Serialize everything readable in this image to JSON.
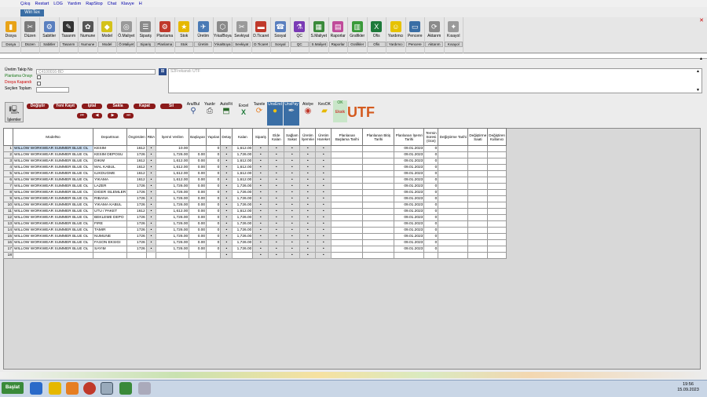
{
  "menu": [
    "Çıkış",
    "Restart",
    "LOG",
    "Yardım",
    "RapStop",
    "Chat",
    "Klavye",
    "H"
  ],
  "window_title": "WinTex",
  "toolbar": [
    {
      "label": "Dosya",
      "sub": "Dosya",
      "color": "#e8a317",
      "glyph": "▮"
    },
    {
      "label": "Düzen",
      "sub": "Düzen",
      "color": "#7a7a7a",
      "glyph": "✂"
    },
    {
      "label": "Sabitler",
      "sub": "Sabitler",
      "color": "#5a7fbf",
      "glyph": "⚙"
    },
    {
      "label": "Tasarım",
      "sub": "Tasarım",
      "color": "#333",
      "glyph": "✎"
    },
    {
      "label": "Numune",
      "sub": "Numune",
      "color": "#555",
      "glyph": "✿"
    },
    {
      "label": "Model",
      "sub": "Model",
      "color": "#d4c21a",
      "glyph": "◆"
    },
    {
      "label": "Ö.Maliyet",
      "sub": "Ö.Maliyet",
      "color": "#9a9a9a",
      "glyph": "◎"
    },
    {
      "label": "Sipariş",
      "sub": "Sipariş",
      "color": "#8a8a8a",
      "glyph": "☰"
    },
    {
      "label": "Planlama",
      "sub": "Planlama",
      "color": "#c0392b",
      "glyph": "⚙"
    },
    {
      "label": "Stok",
      "sub": "Stok",
      "color": "#e6b800",
      "glyph": "★"
    },
    {
      "label": "Üretim",
      "sub": "Üretim",
      "color": "#4a7ab5",
      "glyph": "✈"
    },
    {
      "label": "Yıka/Boya",
      "sub": "Yıka/Boya",
      "color": "#8a8a8a",
      "glyph": "⬡"
    },
    {
      "label": "Sevkiyat",
      "sub": "Sevkiyat",
      "color": "#9a9a9a",
      "glyph": "✂"
    },
    {
      "label": "D.Ticaret",
      "sub": "D.Ticaret",
      "color": "#c0392b",
      "glyph": "▬"
    },
    {
      "label": "Sosyal",
      "sub": "Sosyal",
      "color": "#5a7fbf",
      "glyph": "☎"
    },
    {
      "label": "QC",
      "sub": "QC",
      "color": "#7a3ab5",
      "glyph": "⚗"
    },
    {
      "label": "S.Maliyet",
      "sub": "S.Maliyet",
      "color": "#3a8a3a",
      "glyph": "▦"
    },
    {
      "label": "Raporlar",
      "sub": "Raporlar",
      "color": "#c04a9a",
      "glyph": "▤"
    },
    {
      "label": "Grafikler",
      "sub": "Grafikler",
      "color": "#3a9a3a",
      "glyph": "▥"
    },
    {
      "label": "Ofis",
      "sub": "Ofis",
      "color": "#1e7a3a",
      "glyph": "X"
    },
    {
      "label": "Yardımcı",
      "sub": "Yardımcı",
      "color": "#e6c200",
      "glyph": "☺"
    },
    {
      "label": "Pencere",
      "sub": "Pencere",
      "color": "#3a6ea5",
      "glyph": "▭"
    },
    {
      "label": "Aktarım",
      "sub": "Aktarım",
      "color": "#8a8a8a",
      "glyph": "⟳"
    },
    {
      "label": "Kısayol",
      "sub": "Kısayol",
      "color": "#9a9a9a",
      "glyph": "✦"
    }
  ],
  "form": {
    "uretim_takip_label": "Üretim Takip No",
    "uretim_takip_value": "C4100016-BD",
    "planlama_label": "Planlama Onayı",
    "dosya_label": "Dosya Kapandı",
    "secilen_label": "Seçilen Toplam",
    "model_value": "S2Frekanslı UTF"
  },
  "actions": {
    "degistir": "Değiştir",
    "yeni": "Yeni Kayıt",
    "iptal": "İptal",
    "sakla": "Sakla",
    "kapat": "Kapat",
    "sil": "Sil",
    "islemler": "İşlemler",
    "ara": "Ara/Bul",
    "yazdir": "Yazdır",
    "autofit": "AutoFit",
    "excel": "Excel",
    "tazele": "Tazele",
    "unsel": "UnsEnd",
    "unspay": "UnsPay",
    "atolye": "Atolye",
    "kesok": "KesOK",
    "ok": "OK",
    "eksik": "Eksik"
  },
  "utf_label": "UTF",
  "columns": [
    "ModelNo",
    "Departman",
    "Öngörülen",
    "RBA",
    "İşemri Verilen",
    "Başlayan",
    "Yapılan",
    "Detay",
    "Kalan",
    "Sipariş",
    "Elde Kalan",
    "Sağlam Sakat",
    "Üretim İşemriie",
    "Üretim Hareket",
    "Planlanan Başlama Tarihi",
    "Planlanan Bitiş Tarihi",
    "Planlanan İşemri Tarihi",
    "Termin Süresi (Gün)",
    "Değiştirme Tarihi",
    "Değiştirme Saati",
    "Değiştiren Kullanıcı"
  ],
  "rows": [
    {
      "n": "1",
      "model": "WILLOW WORKWEAR SUMMER BLUE OL",
      "dept": "KESIM",
      "ong": "1612",
      "isemri": "10.00",
      "basl": "",
      "yap": "0",
      "kalan": "1,612.00",
      "tarih": "09.01.2023",
      "termin": "0"
    },
    {
      "n": "2",
      "model": "WILLOW WORKWEAR SUMMER BLUE OL",
      "dept": "KESIM DEPOSU",
      "ong": "1726",
      "isemri": "1,726.00",
      "basl": "0.00",
      "yap": "0",
      "kalan": "1,726.00",
      "tarih": "09.01.2023",
      "termin": "0"
    },
    {
      "n": "3",
      "model": "WILLOW WORKWEAR SUMMER BLUE OL",
      "dept": "DIKIM",
      "ong": "1612",
      "isemri": "1,612.00",
      "basl": "0.00",
      "yap": "0",
      "kalan": "1,612.00",
      "tarih": "09.01.2023",
      "termin": "0"
    },
    {
      "n": "4",
      "model": "WILLOW WORKWEAR SUMMER BLUE OL",
      "dept": "MAL KABUL",
      "ong": "1612",
      "isemri": "1,612.00",
      "basl": "0.00",
      "yap": "0",
      "kalan": "1,612.00",
      "tarih": "09.01.2023",
      "termin": "0"
    },
    {
      "n": "5",
      "model": "WILLOW WORKWEAR SUMMER BLUE OL",
      "dept": "ILIKDUGME",
      "ong": "1612",
      "isemri": "1,612.00",
      "basl": "0.00",
      "yap": "0",
      "kalan": "1,612.00",
      "tarih": "09.01.2023",
      "termin": "0"
    },
    {
      "n": "6",
      "model": "WILLOW WORKWEAR SUMMER BLUE OL",
      "dept": "YIKAMA",
      "ong": "1612",
      "isemri": "1,612.00",
      "basl": "0.00",
      "yap": "0",
      "kalan": "1,612.00",
      "tarih": "09.01.2023",
      "termin": "0"
    },
    {
      "n": "7",
      "model": "WILLOW WORKWEAR SUMMER BLUE OL",
      "dept": "LAZER",
      "ong": "1726",
      "isemri": "1,726.00",
      "basl": "0.00",
      "yap": "0",
      "kalan": "1,726.00",
      "tarih": "09.01.2023",
      "termin": "0"
    },
    {
      "n": "8",
      "model": "WILLOW WORKWEAR SUMMER BLUE OL",
      "dept": "DIGER ISLEMLER",
      "ong": "1726",
      "isemri": "1,726.00",
      "basl": "0.00",
      "yap": "0",
      "kalan": "1,726.00",
      "tarih": "09.01.2023",
      "termin": "0"
    },
    {
      "n": "9",
      "model": "WILLOW WORKWEAR SUMMER BLUE OL",
      "dept": "RIBANA",
      "ong": "1726",
      "isemri": "1,726.00",
      "basl": "0.00",
      "yap": "0",
      "kalan": "1,726.00",
      "tarih": "09.01.2023",
      "termin": "0"
    },
    {
      "n": "10",
      "model": "WILLOW WORKWEAR SUMMER BLUE OL",
      "dept": "YIKAMA KABUL",
      "ong": "1726",
      "isemri": "1,726.00",
      "basl": "0.00",
      "yap": "0",
      "kalan": "1,726.00",
      "tarih": "09.01.2023",
      "termin": "0"
    },
    {
      "n": "11",
      "model": "WILLOW WORKWEAR SUMMER BLUE OL",
      "dept": "UTU / PAKET",
      "ong": "1612",
      "isemri": "1,612.00",
      "basl": "0.00",
      "yap": "0",
      "kalan": "1,612.00",
      "tarih": "09.01.2023",
      "termin": "0"
    },
    {
      "n": "12",
      "model": "WILLOW WORKWEAR SUMMER BLUE OL",
      "dept": "BEKLEME DEPO",
      "ong": "1726",
      "isemri": "1,726.00",
      "basl": "0.00",
      "yap": "0",
      "kalan": "1,726.00",
      "tarih": "09.01.2023",
      "termin": "0"
    },
    {
      "n": "13",
      "model": "WILLOW WORKWEAR SUMMER BLUE OL",
      "dept": "FIRE",
      "ong": "1726",
      "isemri": "1,726.00",
      "basl": "0.00",
      "yap": "0",
      "kalan": "1,726.00",
      "tarih": "09.01.2023",
      "termin": "0"
    },
    {
      "n": "14",
      "model": "WILLOW WORKWEAR SUMMER BLUE OL",
      "dept": "TAMIR",
      "ong": "1726",
      "isemri": "1,726.00",
      "basl": "0.00",
      "yap": "0",
      "kalan": "1,726.00",
      "tarih": "09.01.2023",
      "termin": "0"
    },
    {
      "n": "15",
      "model": "WILLOW WORKWEAR SUMMER BLUE OL",
      "dept": "NUMUNE",
      "ong": "1726",
      "isemri": "1,726.00",
      "basl": "0.00",
      "yap": "0",
      "kalan": "1,726.00",
      "tarih": "09.01.2023",
      "termin": "0"
    },
    {
      "n": "16",
      "model": "WILLOW WORKWEAR SUMMER BLUE OL",
      "dept": "FASON EKSIGI",
      "ong": "1726",
      "isemri": "1,726.00",
      "basl": "0.00",
      "yap": "0",
      "kalan": "1,726.00",
      "tarih": "09.01.2023",
      "termin": "0"
    },
    {
      "n": "17",
      "model": "WILLOW WORKWEAR SUMMER BLUE OL",
      "dept": "SAYIM",
      "ong": "1726",
      "isemri": "1,726.00",
      "basl": "0.00",
      "yap": "0",
      "kalan": "1,726.00",
      "tarih": "09.01.2023",
      "termin": "0"
    },
    {
      "n": "18",
      "model": "",
      "dept": "",
      "ong": "",
      "isemri": "",
      "basl": "",
      "yap": "",
      "kalan": "",
      "tarih": "",
      "termin": ""
    }
  ],
  "taskbar": {
    "start": "Başlat",
    "time": "19:56",
    "date": "15.09.2023"
  }
}
